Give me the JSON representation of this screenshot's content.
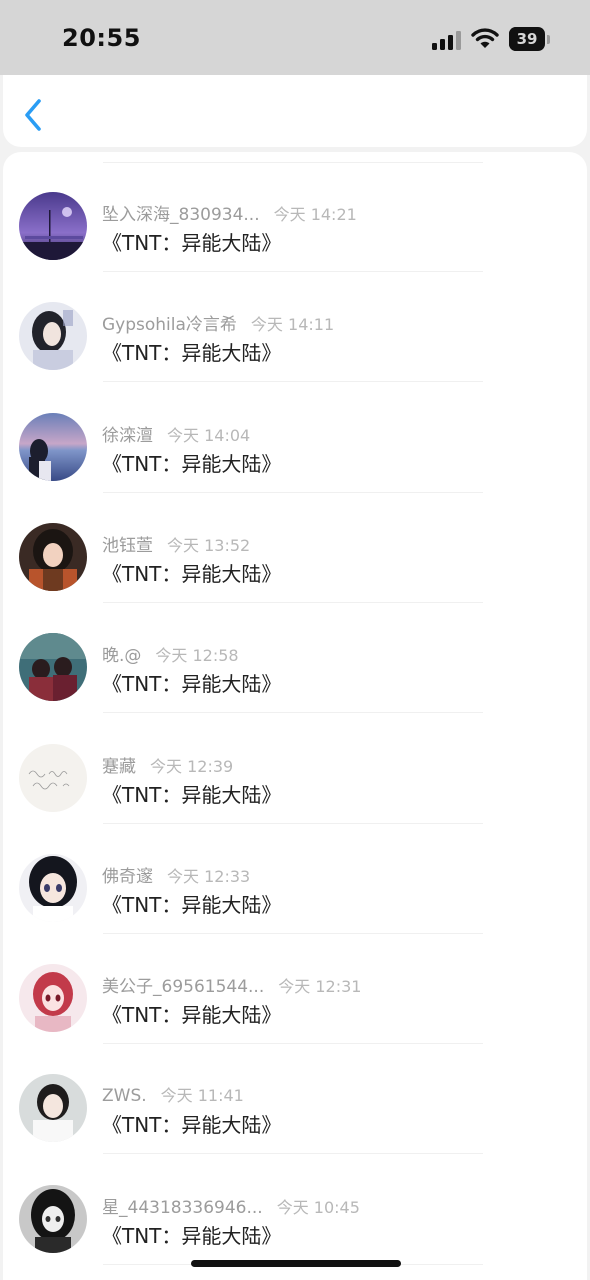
{
  "status_bar": {
    "time": "20:55",
    "battery": "39",
    "battery_percent": 39
  },
  "nav": {
    "back_icon": "chevron-left-icon",
    "accent_color": "#2a9df4"
  },
  "rows": [
    {
      "name": "坠入深海_830934...",
      "time": "今天 14:21",
      "message": "《TNT：异能大陆》",
      "avatar": "night-sky"
    },
    {
      "name": "Gypsohila冷言希",
      "time": "今天 14:11",
      "message": "《TNT：异能大陆》",
      "avatar": "girl-portrait"
    },
    {
      "name": "徐滦澶",
      "time": "今天 14:04",
      "message": "《TNT：异能大陆》",
      "avatar": "sea-sunset"
    },
    {
      "name": "池钰萱",
      "time": "今天 13:52",
      "message": "《TNT：异能大陆》",
      "avatar": "anime-girl-brown"
    },
    {
      "name": "晚.@",
      "time": "今天 12:58",
      "message": "《TNT：异能大陆》",
      "avatar": "couple-teal"
    },
    {
      "name": "蹇藏",
      "time": "今天 12:39",
      "message": "《TNT：异能大陆》",
      "avatar": "handwriting"
    },
    {
      "name": "佛奇邃",
      "time": "今天 12:33",
      "message": "《TNT：异能大陆》",
      "avatar": "anime-girl-dark"
    },
    {
      "name": "美公子_69561544...",
      "time": "今天 12:31",
      "message": "《TNT：异能大陆》",
      "avatar": "anime-red"
    },
    {
      "name": "ZWS.",
      "time": "今天 11:41",
      "message": "《TNT：异能大陆》",
      "avatar": "girl-white"
    },
    {
      "name": "星_44318336946...",
      "time": "今天 10:45",
      "message": "《TNT：异能大陆》",
      "avatar": "anime-bw"
    }
  ]
}
